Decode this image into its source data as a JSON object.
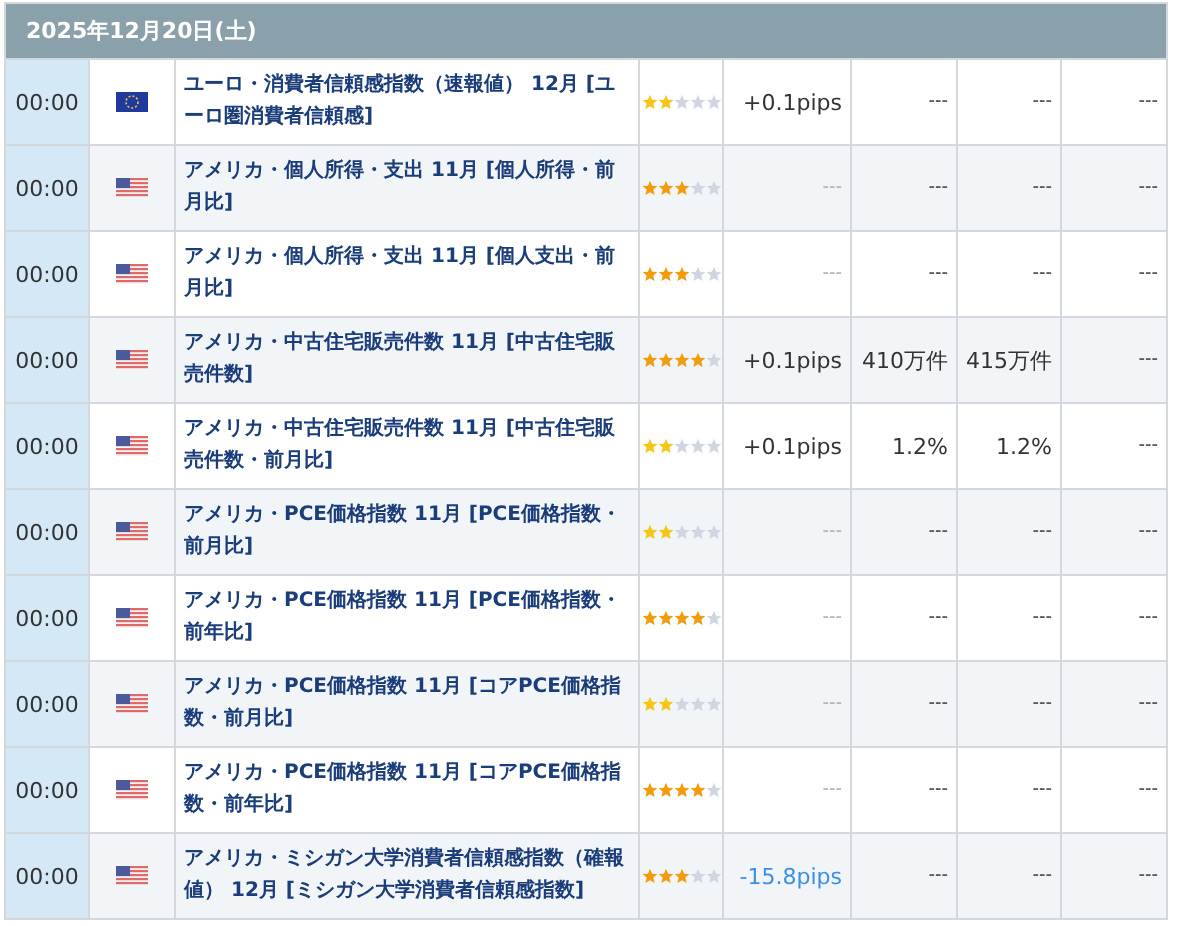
{
  "date_header": "2025年12月20日(土)",
  "rows": [
    {
      "time": "00:00",
      "flag": {
        "kind": "eu"
      },
      "name": "ユーロ・消費者信頼感指数（速報値） 12月 [ユーロ圏消費者信頼感]",
      "importance": {
        "stars": 2,
        "color": "#f5c518"
      },
      "pips": {
        "text": "+0.1pips",
        "color": "#333333"
      },
      "column_6": "---",
      "column_7": "---",
      "column_8": "---"
    },
    {
      "time": "00:00",
      "flag": {
        "kind": "us"
      },
      "name": "アメリカ・個人所得・支出 11月 [個人所得・前月比]",
      "importance": {
        "stars": 3,
        "color": "#f29b0c"
      },
      "pips": {
        "text": "---"
      },
      "column_6": "---",
      "column_7": "---",
      "column_8": "---"
    },
    {
      "time": "00:00",
      "flag": {
        "kind": "us"
      },
      "name": "アメリカ・個人所得・支出 11月 [個人支出・前月比]",
      "importance": {
        "stars": 3,
        "color": "#f29b0c"
      },
      "pips": {
        "text": "---"
      },
      "column_6": "---",
      "column_7": "---",
      "column_8": "---"
    },
    {
      "time": "00:00",
      "flag": {
        "kind": "us"
      },
      "name": "アメリカ・中古住宅販売件数 11月 [中古住宅販売件数]",
      "importance": {
        "stars": 4,
        "color": "#f29b0c"
      },
      "pips": {
        "text": "+0.1pips",
        "color": "#333333"
      },
      "column_6": "410万件",
      "column_7": "415万件",
      "column_8": "---"
    },
    {
      "time": "00:00",
      "flag": {
        "kind": "us"
      },
      "name": "アメリカ・中古住宅販売件数 11月 [中古住宅販売件数・前月比]",
      "importance": {
        "stars": 2,
        "color": "#f5c518"
      },
      "pips": {
        "text": "+0.1pips",
        "color": "#333333"
      },
      "column_6": "1.2%",
      "column_7": "1.2%",
      "column_8": "---"
    },
    {
      "time": "00:00",
      "flag": {
        "kind": "us"
      },
      "name": "アメリカ・PCE価格指数 11月 [PCE価格指数・前月比]",
      "importance": {
        "stars": 2,
        "color": "#f5c518"
      },
      "pips": {
        "text": "---"
      },
      "column_6": "---",
      "column_7": "---",
      "column_8": "---"
    },
    {
      "time": "00:00",
      "flag": {
        "kind": "us"
      },
      "name": "アメリカ・PCE価格指数 11月 [PCE価格指数・前年比]",
      "importance": {
        "stars": 4,
        "color": "#f29b0c"
      },
      "pips": {
        "text": "---"
      },
      "column_6": "---",
      "column_7": "---",
      "column_8": "---"
    },
    {
      "time": "00:00",
      "flag": {
        "kind": "us"
      },
      "name": "アメリカ・PCE価格指数 11月 [コアPCE価格指数・前月比]",
      "importance": {
        "stars": 2,
        "color": "#f5c518"
      },
      "pips": {
        "text": "---"
      },
      "column_6": "---",
      "column_7": "---",
      "column_8": "---"
    },
    {
      "time": "00:00",
      "flag": {
        "kind": "us"
      },
      "name": "アメリカ・PCE価格指数 11月 [コアPCE価格指数・前年比]",
      "importance": {
        "stars": 4,
        "color": "#f29b0c"
      },
      "pips": {
        "text": "---"
      },
      "column_6": "---",
      "column_7": "---",
      "column_8": "---"
    },
    {
      "time": "00:00",
      "flag": {
        "kind": "us"
      },
      "name": "アメリカ・ミシガン大学消費者信頼感指数（確報値） 12月 [ミシガン大学消費者信頼感指数]",
      "importance": {
        "stars": 3,
        "color": "#f29b0c"
      },
      "pips": {
        "text": "-15.8pips",
        "color": "#3d8fe6"
      },
      "column_6": "---",
      "column_7": "---",
      "column_8": "---"
    }
  ]
}
